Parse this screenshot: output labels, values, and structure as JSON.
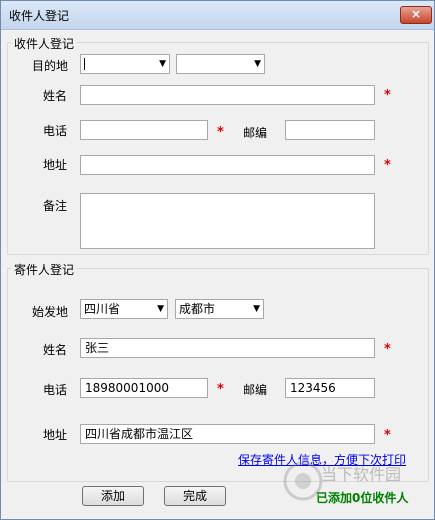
{
  "window": {
    "title": "收件人登记",
    "close_icon": "×"
  },
  "recipient": {
    "group_label": "收件人登记",
    "destination_label": "目的地",
    "province_value": "",
    "city_value": "",
    "name_label": "姓名",
    "name_value": "",
    "phone_label": "电话",
    "phone_value": "",
    "zip_label": "邮编",
    "zip_value": "",
    "address_label": "地址",
    "address_value": "",
    "note_label": "备注",
    "note_value": ""
  },
  "sender": {
    "group_label": "寄件人登记",
    "origin_label": "始发地",
    "province_value": "四川省",
    "city_value": "成都市",
    "name_label": "姓名",
    "name_value": "张三",
    "phone_label": "电话",
    "phone_value": "18980001000",
    "zip_label": "邮编",
    "zip_value": "123456",
    "address_label": "地址",
    "address_value": "四川省成都市温江区",
    "save_link": "保存寄件人信息，方便下次打印"
  },
  "required_mark": "*",
  "dropdown_arrow": "▼",
  "footer": {
    "add_button": "添加",
    "finish_button": "完成",
    "status": "已添加0位收件人"
  },
  "watermark": {
    "text": "当下软件园"
  },
  "colors": {
    "required": "#e00000",
    "link": "#0000ee",
    "status": "#008000"
  }
}
